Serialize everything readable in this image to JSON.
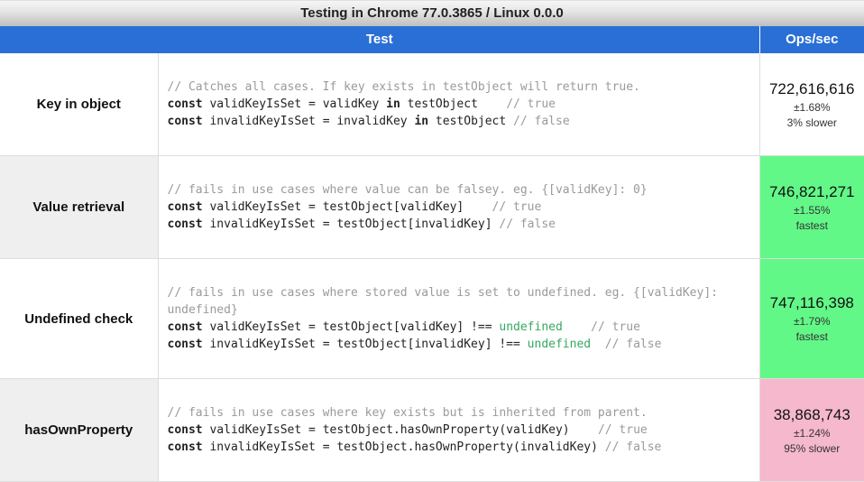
{
  "header": {
    "title": "Testing in Chrome 77.0.3865 / Linux 0.0.0"
  },
  "columns": {
    "test": "Test",
    "ops": "Ops/sec"
  },
  "rows": [
    {
      "name": "Key in object",
      "code_tokens": [
        {
          "t": "// Catches all cases. If key exists in testObject will return true.",
          "c": "c"
        },
        {
          "t": "\n"
        },
        {
          "t": "const",
          "c": "kw"
        },
        {
          "t": " validKeyIsSet = validKey "
        },
        {
          "t": "in",
          "c": "kw"
        },
        {
          "t": " testObject    "
        },
        {
          "t": "// true",
          "c": "c"
        },
        {
          "t": "\n"
        },
        {
          "t": "const",
          "c": "kw"
        },
        {
          "t": " invalidKeyIsSet = invalidKey "
        },
        {
          "t": "in",
          "c": "kw"
        },
        {
          "t": " testObject "
        },
        {
          "t": "// false",
          "c": "c"
        }
      ],
      "ops": {
        "value": "722,616,616",
        "pm": "±1.68%",
        "note": "3% slower",
        "class": ""
      }
    },
    {
      "name": "Value retrieval",
      "code_tokens": [
        {
          "t": "// fails in use cases where value can be falsey. eg. {[validKey]: 0}",
          "c": "c"
        },
        {
          "t": "\n"
        },
        {
          "t": "const",
          "c": "kw"
        },
        {
          "t": " validKeyIsSet = testObject[validKey]    "
        },
        {
          "t": "// true",
          "c": "c"
        },
        {
          "t": "\n"
        },
        {
          "t": "const",
          "c": "kw"
        },
        {
          "t": " invalidKeyIsSet = testObject[invalidKey] "
        },
        {
          "t": "// false",
          "c": "c"
        }
      ],
      "ops": {
        "value": "746,821,271",
        "pm": "±1.55%",
        "note": "fastest",
        "class": "fastest"
      }
    },
    {
      "name": "Undefined check",
      "code_tokens": [
        {
          "t": "// fails in use cases where stored value is set to undefined. eg. {[validKey]:\nundefined}",
          "c": "c"
        },
        {
          "t": "\n"
        },
        {
          "t": "const",
          "c": "kw"
        },
        {
          "t": " validKeyIsSet = testObject[validKey] !== "
        },
        {
          "t": "undefined",
          "c": "lit"
        },
        {
          "t": "    "
        },
        {
          "t": "// true",
          "c": "c"
        },
        {
          "t": "\n"
        },
        {
          "t": "const",
          "c": "kw"
        },
        {
          "t": " invalidKeyIsSet = testObject[invalidKey] !== "
        },
        {
          "t": "undefined",
          "c": "lit"
        },
        {
          "t": "  "
        },
        {
          "t": "// false",
          "c": "c"
        }
      ],
      "ops": {
        "value": "747,116,398",
        "pm": "±1.79%",
        "note": "fastest",
        "class": "fastest"
      }
    },
    {
      "name": "hasOwnProperty",
      "code_tokens": [
        {
          "t": "// fails in use cases where key exists but is inherited from parent.",
          "c": "c"
        },
        {
          "t": "\n"
        },
        {
          "t": "const",
          "c": "kw"
        },
        {
          "t": " validKeyIsSet = testObject.hasOwnProperty(validKey)    "
        },
        {
          "t": "// true",
          "c": "c"
        },
        {
          "t": "\n"
        },
        {
          "t": "const",
          "c": "kw"
        },
        {
          "t": " invalidKeyIsSet = testObject.hasOwnProperty(invalidKey) "
        },
        {
          "t": "// false",
          "c": "c"
        }
      ],
      "ops": {
        "value": "38,868,743",
        "pm": "±1.24%",
        "note": "95% slower",
        "class": "slowest"
      }
    }
  ]
}
